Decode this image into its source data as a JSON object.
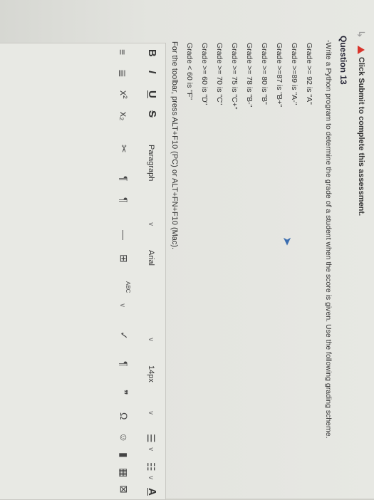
{
  "assessment": {
    "notice": "Click Submit to complete this assessment.",
    "question_title": "Question 13",
    "question_text": "-Write a Python program to determine the grade of a student when the score is given. Use the following grading scheme.",
    "grades": [
      "Grade >= 92 is \"A\"",
      "Grade >=89 is \"A-\"",
      "Grade >=87 is \"B+\"",
      "Grade >= 80 is \"B\"",
      "Grade >= 78 is \"B-\"",
      "Grade >= 75 is \"C+\"",
      "Grade >= 70 is \"C\"",
      "Grade >= 60 is \"D\"",
      "Grade < 60 is \"F\""
    ],
    "toolbar_hint": "For the toolbar, press ALT+F10 (PC) or ALT+FN+F10 (Mac)."
  },
  "editor": {
    "bold": "B",
    "italic": "I",
    "underline": "U",
    "strike": "S",
    "paragraph": "Paragraph",
    "font": "Arial",
    "size": "14px",
    "text_color": "A",
    "superscript": "x²",
    "subscript": "x₂",
    "spell": "ABC"
  },
  "colors": {
    "warning": "#d9342b",
    "cursor": "#3b6db0"
  }
}
